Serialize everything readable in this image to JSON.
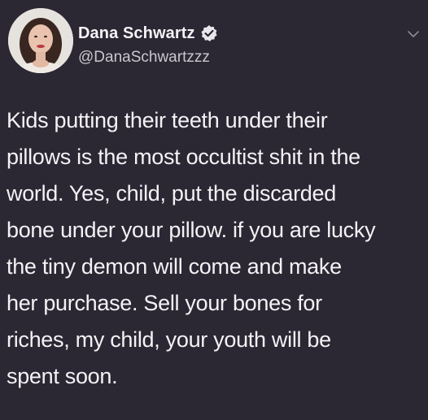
{
  "author": {
    "display_name": "Dana Schwartz",
    "handle": "@DanaSchwartzzz",
    "verified": true,
    "avatar_icon": "profile-photo"
  },
  "tweet": {
    "text": "Kids putting their teeth under their\npillows is the most occultist shit in the\nworld. Yes, child, put the discarded\nbone under your pillow. if you are lucky\nthe tiny demon will come and make\nher purchase. Sell your bones for\nriches, my child, your youth will be\nspent soon."
  },
  "colors": {
    "background": "#2b2733",
    "text": "#f3f3f5",
    "verified_badge": "#e8e8ec"
  },
  "icons": {
    "verified": "verified-badge-icon",
    "menu": "chevron-down-icon"
  }
}
